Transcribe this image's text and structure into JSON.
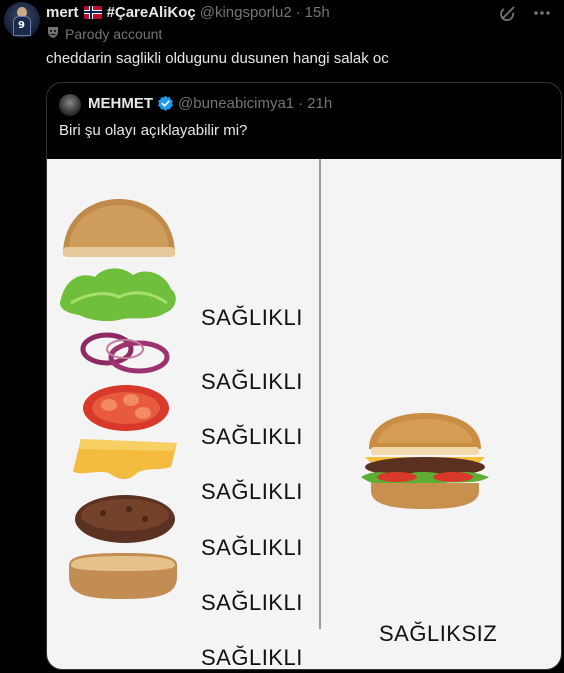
{
  "tweet": {
    "display_name_pre": "mert",
    "display_name_post": "#ÇareAliKoç",
    "handle": "@kingsporlu2",
    "separator": "·",
    "time": "15h",
    "avatar_number": "9",
    "parody_label": "Parody account",
    "text": "cheddarin saglikli oldugunu dusunen hangi salak oc"
  },
  "quote": {
    "name": "MEHMET",
    "handle": "@buneabicimya1",
    "separator": "·",
    "time": "21h",
    "text": "Biri şu olayı açıklayabilir mi?"
  },
  "image": {
    "ingredients": [
      {
        "name": "top-bun",
        "label": "SAĞLIKLI"
      },
      {
        "name": "lettuce",
        "label": "SAĞLIKLI"
      },
      {
        "name": "onion",
        "label": "SAĞLIKLI"
      },
      {
        "name": "tomato",
        "label": "SAĞLIKLI"
      },
      {
        "name": "cheese",
        "label": "SAĞLIKLI"
      },
      {
        "name": "patty",
        "label": "SAĞLIKLI"
      },
      {
        "name": "bottom-bun",
        "label": "SAĞLIKLI"
      }
    ],
    "burger_label": "SAĞLIKSIZ"
  },
  "colors": {
    "background": "#000000",
    "text_primary": "#e7e9ea",
    "text_secondary": "#71767b",
    "verified_blue": "#1d9bf0",
    "border": "#2f3336"
  },
  "icons": [
    "grok-icon",
    "more-icon",
    "parody-mask-icon",
    "verified-badge-icon",
    "norway-flag-icon"
  ]
}
